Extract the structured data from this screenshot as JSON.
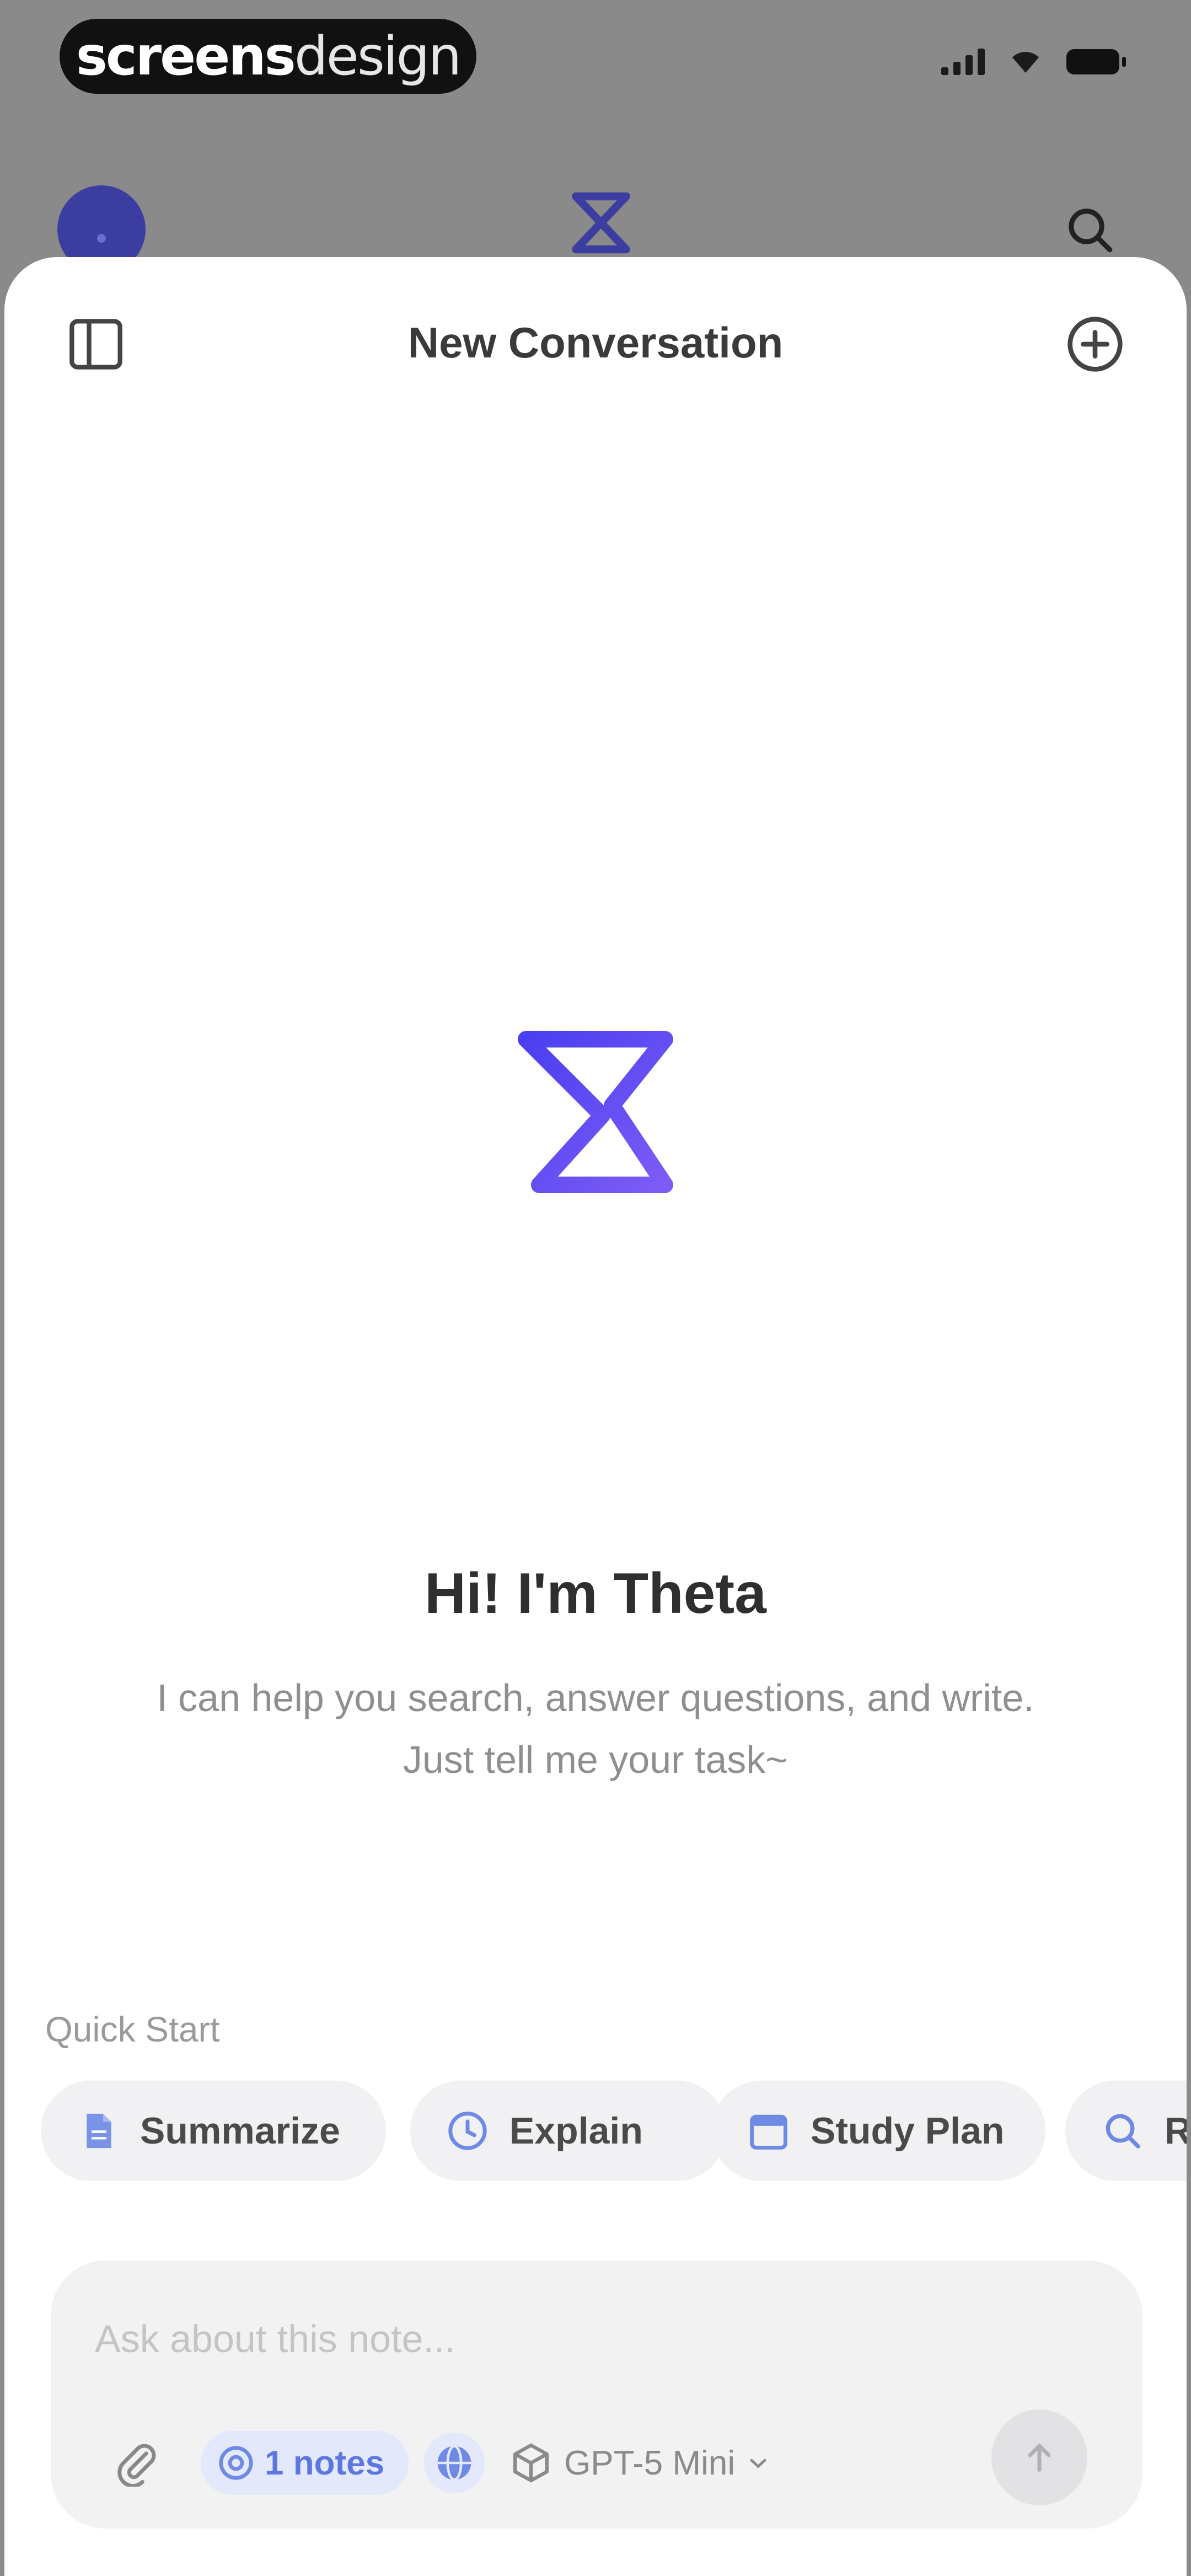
{
  "status_bar": {
    "brand_bold": "screens",
    "brand_thin": "design"
  },
  "header": {
    "title": "New Conversation"
  },
  "hero": {
    "title": "Hi! I'm Theta",
    "subtitle": "I can help you search, answer questions, and write. Just tell me your task~"
  },
  "quick_start": {
    "label": "Quick Start",
    "chips": [
      {
        "label": "Summarize",
        "icon": "document-icon"
      },
      {
        "label": "Explain",
        "icon": "clock-icon"
      },
      {
        "label": "Study Plan",
        "icon": "calendar-icon"
      },
      {
        "label": "Research",
        "icon": "search-icon"
      }
    ]
  },
  "composer": {
    "placeholder": "Ask about this note...",
    "notes_label": "1 notes",
    "model_label": "GPT-5 Mini"
  },
  "colors": {
    "accent": "#5b4ef0",
    "chip_bg": "#f1f1f3",
    "notes_pill_bg": "#e3e8fb"
  }
}
